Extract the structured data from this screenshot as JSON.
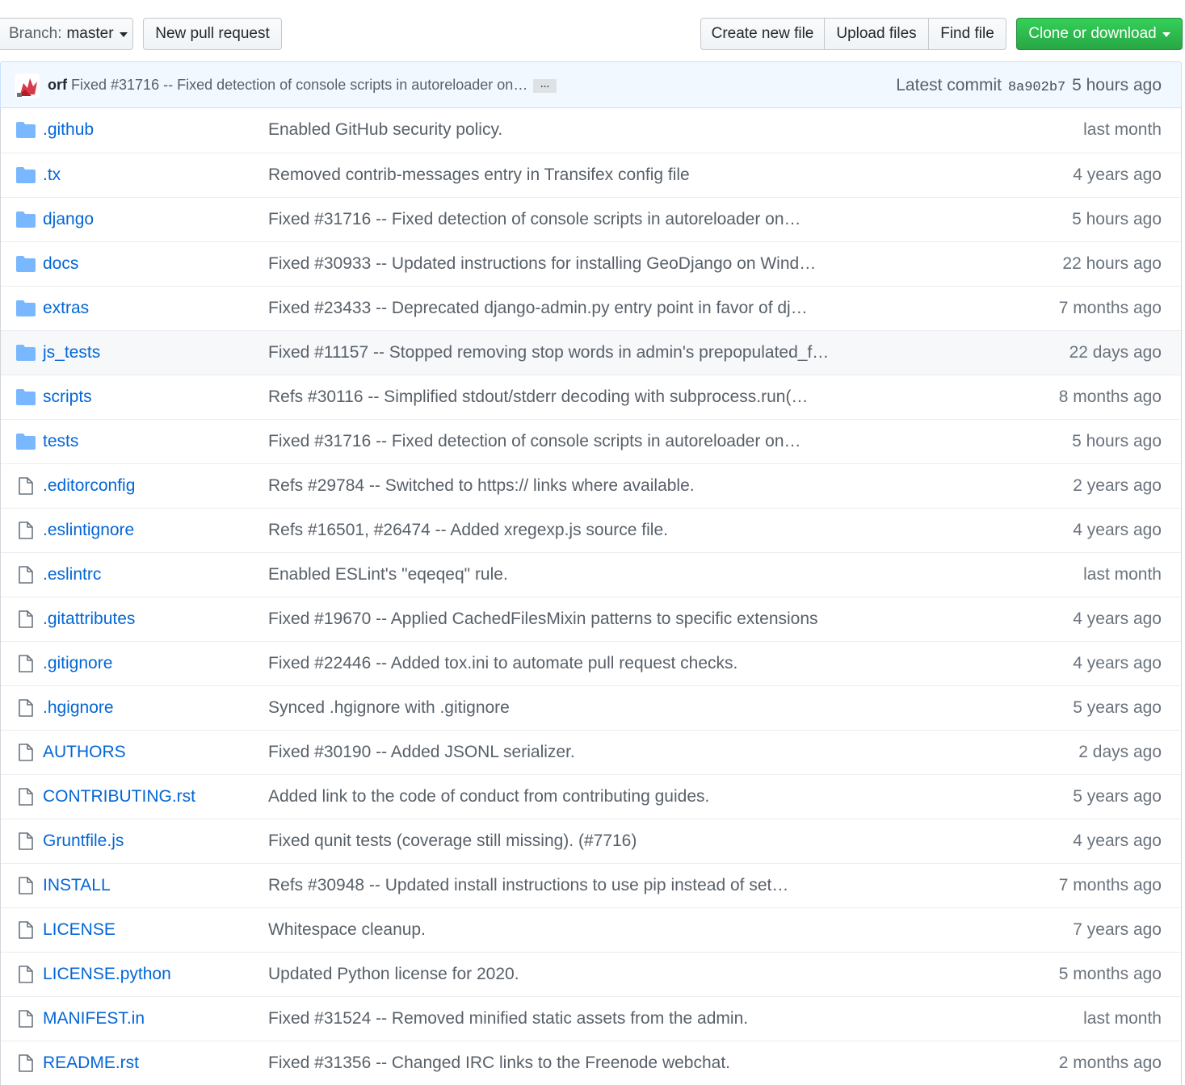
{
  "toolbar": {
    "branch_label": "Branch:",
    "branch_value": "master",
    "new_pr": "New pull request",
    "create_file": "Create new file",
    "upload_files": "Upload files",
    "find_file": "Find file",
    "clone": "Clone or download"
  },
  "commit": {
    "author": "orf",
    "message": "Fixed #31716 -- Fixed detection of console scripts in autoreloader on…",
    "ellipsis": "…",
    "latest_label": "Latest commit",
    "sha": "8a902b7",
    "time": "5 hours ago"
  },
  "colors": {
    "link": "#0366d6",
    "folder": "#79b8ff",
    "clone_green": "#28a745",
    "commit_bg": "#f1f8ff"
  },
  "files": [
    {
      "type": "dir",
      "name": ".github",
      "message": "Enabled GitHub security policy.",
      "age": "last month"
    },
    {
      "type": "dir",
      "name": ".tx",
      "message": "Removed contrib-messages entry in Transifex config file",
      "age": "4 years ago"
    },
    {
      "type": "dir",
      "name": "django",
      "message": "Fixed #31716 -- Fixed detection of console scripts in autoreloader on…",
      "age": "5 hours ago"
    },
    {
      "type": "dir",
      "name": "docs",
      "message": "Fixed #30933 -- Updated instructions for installing GeoDjango on Wind…",
      "age": "22 hours ago"
    },
    {
      "type": "dir",
      "name": "extras",
      "message": "Fixed #23433 -- Deprecated django-admin.py entry point in favor of dj…",
      "age": "7 months ago"
    },
    {
      "type": "dir",
      "name": "js_tests",
      "message": "Fixed #11157 -- Stopped removing stop words in admin's prepopulated_f…",
      "age": "22 days ago",
      "hover": true
    },
    {
      "type": "dir",
      "name": "scripts",
      "message": "Refs #30116 -- Simplified stdout/stderr decoding with subprocess.run(…",
      "age": "8 months ago"
    },
    {
      "type": "dir",
      "name": "tests",
      "message": "Fixed #31716 -- Fixed detection of console scripts in autoreloader on…",
      "age": "5 hours ago"
    },
    {
      "type": "file",
      "name": ".editorconfig",
      "message": "Refs #29784 -- Switched to https:// links where available.",
      "age": "2 years ago"
    },
    {
      "type": "file",
      "name": ".eslintignore",
      "message": "Refs #16501, #26474 -- Added xregexp.js source file.",
      "age": "4 years ago"
    },
    {
      "type": "file",
      "name": ".eslintrc",
      "message": "Enabled ESLint's \"eqeqeq\" rule.",
      "age": "last month"
    },
    {
      "type": "file",
      "name": ".gitattributes",
      "message": "Fixed #19670 -- Applied CachedFilesMixin patterns to specific extensions",
      "age": "4 years ago"
    },
    {
      "type": "file",
      "name": ".gitignore",
      "message": "Fixed #22446 -- Added tox.ini to automate pull request checks.",
      "age": "4 years ago"
    },
    {
      "type": "file",
      "name": ".hgignore",
      "message": "Synced .hgignore with .gitignore",
      "age": "5 years ago"
    },
    {
      "type": "file",
      "name": "AUTHORS",
      "message": "Fixed #30190 -- Added JSONL serializer.",
      "age": "2 days ago"
    },
    {
      "type": "file",
      "name": "CONTRIBUTING.rst",
      "message": "Added link to the code of conduct from contributing guides.",
      "age": "5 years ago"
    },
    {
      "type": "file",
      "name": "Gruntfile.js",
      "message": "Fixed qunit tests (coverage still missing). (#7716)",
      "age": "4 years ago"
    },
    {
      "type": "file",
      "name": "INSTALL",
      "message": "Refs #30948 -- Updated install instructions to use pip instead of set…",
      "age": "7 months ago"
    },
    {
      "type": "file",
      "name": "LICENSE",
      "message": "Whitespace cleanup.",
      "age": "7 years ago"
    },
    {
      "type": "file",
      "name": "LICENSE.python",
      "message": "Updated Python license for 2020.",
      "age": "5 months ago"
    },
    {
      "type": "file",
      "name": "MANIFEST.in",
      "message": "Fixed #31524 -- Removed minified static assets from the admin.",
      "age": "last month"
    },
    {
      "type": "file",
      "name": "README.rst",
      "message": "Fixed #31356 -- Changed IRC links to the Freenode webchat.",
      "age": "2 months ago"
    }
  ]
}
